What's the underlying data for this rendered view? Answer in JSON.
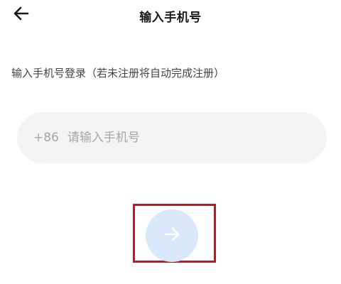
{
  "header": {
    "back_icon": "arrow-left-icon",
    "title": "输入手机号"
  },
  "main": {
    "instruction": "输入手机号登录（若未注册将自动完成注册）",
    "phone": {
      "country_code": "+86",
      "placeholder": "请输入手机号",
      "value": ""
    },
    "next_button": {
      "icon": "arrow-right-icon",
      "color": "#d9e9fb"
    }
  },
  "colors": {
    "highlight": "#b51d24",
    "input_bg": "#f4f4f4",
    "placeholder": "#a7a7a7"
  }
}
